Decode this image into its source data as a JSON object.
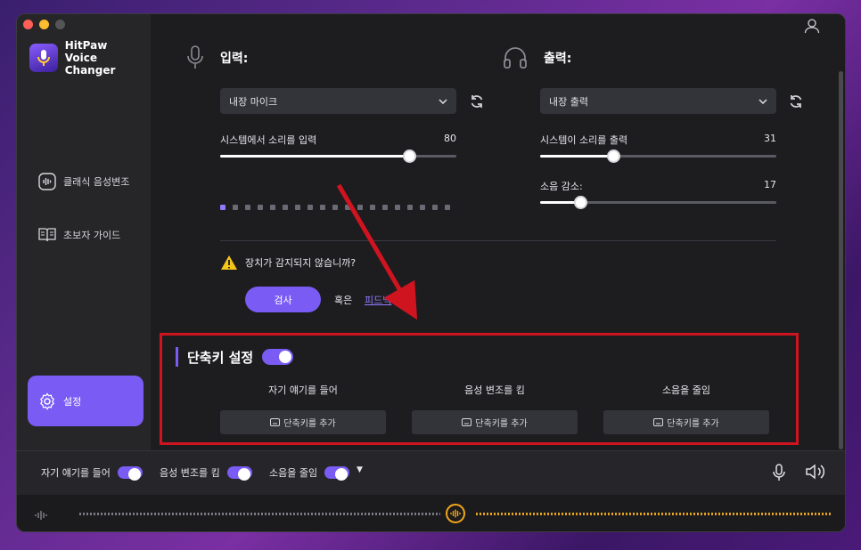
{
  "app": {
    "name_line1": "HitPaw",
    "name_line2": "Voice Changer"
  },
  "sidebar": {
    "items": [
      {
        "label": "클래식 음성변조",
        "icon": "waveform-icon"
      },
      {
        "label": "초보자 가이드",
        "icon": "book-icon"
      },
      {
        "label": "설정",
        "icon": "gear-icon",
        "active": true
      }
    ]
  },
  "input": {
    "title": "입력:",
    "device": "내장 마이크",
    "volume_label": "시스템에서 소리를 입력",
    "volume_value": "80",
    "level_dots_total": 19,
    "level_dots_active": 1
  },
  "output": {
    "title": "출력:",
    "device": "내장 출력",
    "volume_label": "시스템이 소리를 출력",
    "volume_value": "31",
    "noise_label": "소음 감소:",
    "noise_value": "17"
  },
  "device_help": {
    "question": "장치가 감지되지 않습니까?",
    "check_button": "검사",
    "or_text": "혹은",
    "feedback_link": "피드백"
  },
  "shortcuts": {
    "title": "단축키 설정",
    "enabled": true,
    "columns": [
      {
        "label": "자기 얘기를 들어",
        "button": "단축키를 추가"
      },
      {
        "label": "음성 변조를 킴",
        "button": "단축키를 추가"
      },
      {
        "label": "소음을 줄임",
        "button": "단축키를 추가"
      }
    ]
  },
  "bottom_bar": {
    "toggles": [
      {
        "label": "자기 얘기를 들어",
        "on": true
      },
      {
        "label": "음성 변조를 킴",
        "on": true
      },
      {
        "label": "소음을 줄임",
        "on": true
      }
    ]
  },
  "colors": {
    "accent": "#7a5cf5",
    "highlight": "#d0141f",
    "wave_active": "#e6a51c"
  }
}
